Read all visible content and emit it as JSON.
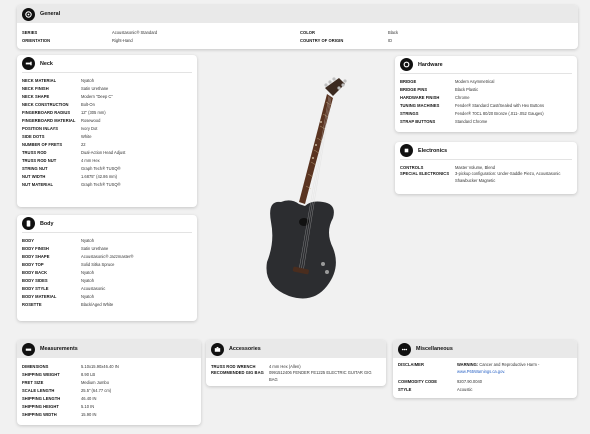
{
  "general": {
    "title": "General",
    "rows": [
      {
        "l1": "SERIES",
        "v1": "Acoustasonic® Standard",
        "l2": "COLOR",
        "v2": "Black"
      },
      {
        "l1": "ORIENTATION",
        "v1": "Right-Hand",
        "l2": "COUNTRY OF ORIGIN",
        "v2": "ID"
      }
    ]
  },
  "neck": {
    "title": "Neck",
    "rows": [
      {
        "label": "NECK MATERIAL",
        "value": "Nyatoh"
      },
      {
        "label": "NECK FINISH",
        "value": "Satin Urethane"
      },
      {
        "label": "NECK SHAPE",
        "value": "Modern \"Deep C\""
      },
      {
        "label": "NECK CONSTRUCTION",
        "value": "Bolt-On"
      },
      {
        "label": "FINGERBOARD RADIUS",
        "value": "12\" (305 mm)"
      },
      {
        "label": "FINGERBOARD MATERIAL",
        "value": "Rosewood"
      },
      {
        "label": "POSITION INLAYS",
        "value": "Ivory Dot"
      },
      {
        "label": "SIDE DOTS",
        "value": "White"
      },
      {
        "label": "NUMBER OF FRETS",
        "value": "22"
      },
      {
        "label": "TRUSS ROD",
        "value": "Dual-Action Head Adjust"
      },
      {
        "label": "TRUSS ROD NUT",
        "value": "4 mm Hex"
      },
      {
        "label": "STRING NUT",
        "value": "Graph Tech® TUSQ®"
      },
      {
        "label": "NUT WIDTH",
        "value": "1.6875\" (42.86 mm)"
      },
      {
        "label": "NUT MATERIAL",
        "value": "Graph Tech® TUSQ®"
      }
    ]
  },
  "body": {
    "title": "Body",
    "rows": [
      {
        "label": "BODY",
        "value": "Nyatoh"
      },
      {
        "label": "BODY FINISH",
        "value": "Satin Urethane"
      },
      {
        "label": "BODY SHAPE",
        "value": "Acoustasonic® Jazzmaster®"
      },
      {
        "label": "BODY TOP",
        "value": "Solid Sitka Spruce"
      },
      {
        "label": "BODY BACK",
        "value": "Nyatoh"
      },
      {
        "label": "BODY SIDES",
        "value": "Nyatoh"
      },
      {
        "label": "BODY STYLE",
        "value": "Acoustasonic"
      },
      {
        "label": "BODY MATERIAL",
        "value": "Nyatoh"
      },
      {
        "label": "ROSETTE",
        "value": "Black/Aged White"
      }
    ]
  },
  "hardware": {
    "title": "Hardware",
    "rows": [
      {
        "label": "BRIDGE",
        "value": "Modern Asymmetrical"
      },
      {
        "label": "BRIDGE PINS",
        "value": "Black Plastic"
      },
      {
        "label": "HARDWARE FINISH",
        "value": "Chrome"
      },
      {
        "label": "TUNING MACHINES",
        "value": "Fender® Standard Cast/Sealed with Hex Buttons"
      },
      {
        "label": "STRINGS",
        "value": "Fender® 70CL 80/20 Bronze (.011-.052 Gauges)"
      },
      {
        "label": "STRAP BUTTONS",
        "value": "Standard Chrome"
      }
    ]
  },
  "electronics": {
    "title": "Electronics",
    "rows": [
      {
        "label": "CONTROLS",
        "value": "Master Volume, Blend"
      },
      {
        "label": "SPECIAL ELECTRONICS",
        "value": "3-pickup configuration: Under-Saddle Piezo, Acoustasonic Shawbucker Magnetic"
      }
    ]
  },
  "measurements": {
    "title": "Measurements",
    "rows": [
      {
        "label": "DIMENSIONS",
        "value": "5.10x15.90x46.40 IN"
      },
      {
        "label": "SHIPPING WEIGHT",
        "value": "8.90 LB"
      },
      {
        "label": "FRET SIZE",
        "value": "Medium Jumbo"
      },
      {
        "label": "SCALE LENGTH",
        "value": "25.5\" (64.77 cm)"
      },
      {
        "label": "SHIPPING LENGTH",
        "value": "46.40 IN"
      },
      {
        "label": "SHIPPING HEIGHT",
        "value": "5.10 IN"
      },
      {
        "label": "SHIPPING WIDTH",
        "value": "15.90 IN"
      }
    ]
  },
  "accessories": {
    "title": "Accessories",
    "rows": [
      {
        "label": "TRUSS ROD WRENCH",
        "value": "4 mm Hex (Allen)"
      },
      {
        "label": "RECOMMENDED GIG BAG",
        "value": "0991512406 FENDER FE1225 ELECTRIC GUITAR GIG BAG"
      }
    ]
  },
  "misc": {
    "title": "Miscellaneous",
    "disclaimer_label": "DISCLAIMER",
    "disclaimer_bold": "WARNING:",
    "disclaimer_text": " Cancer and Reproductive Harm -",
    "disclaimer_link": "www.P65Warnings.ca.gov.",
    "rows": [
      {
        "label": "COMMODITY CODE",
        "value": "9207.90.0040"
      },
      {
        "label": "STYLE",
        "value": "Acoustic"
      }
    ]
  },
  "colors": {
    "link": "#2a63c5",
    "guitar_body": "#2c2d30",
    "fingerboard": "#5a3421"
  }
}
